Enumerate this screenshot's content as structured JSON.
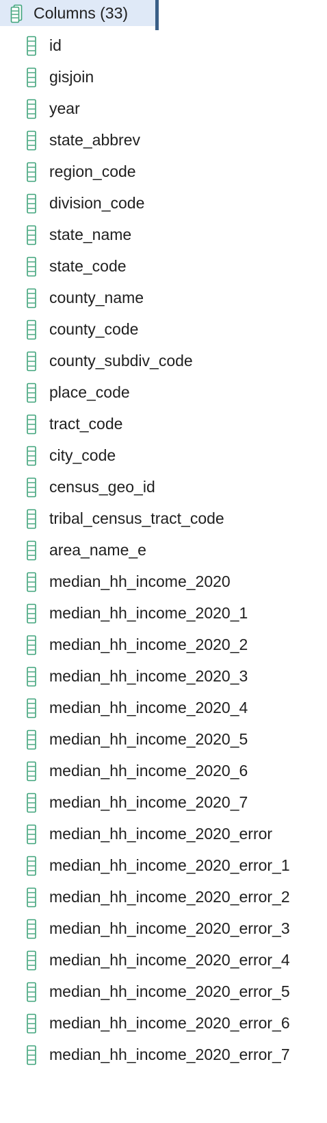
{
  "accent": {
    "icon_green": "#3fa37a",
    "selection_bg": "#dfe9f7",
    "selection_bar": "#3a5f87"
  },
  "header": {
    "label": "Columns (33)",
    "icon": "columns-folder-icon"
  },
  "column_icon": "column-icon",
  "columns": [
    {
      "name": "id"
    },
    {
      "name": "gisjoin"
    },
    {
      "name": "year"
    },
    {
      "name": "state_abbrev"
    },
    {
      "name": "region_code"
    },
    {
      "name": "division_code"
    },
    {
      "name": "state_name"
    },
    {
      "name": "state_code"
    },
    {
      "name": "county_name"
    },
    {
      "name": "county_code"
    },
    {
      "name": "county_subdiv_code"
    },
    {
      "name": "place_code"
    },
    {
      "name": "tract_code"
    },
    {
      "name": "city_code"
    },
    {
      "name": "census_geo_id"
    },
    {
      "name": "tribal_census_tract_code"
    },
    {
      "name": "area_name_e"
    },
    {
      "name": "median_hh_income_2020"
    },
    {
      "name": "median_hh_income_2020_1"
    },
    {
      "name": "median_hh_income_2020_2"
    },
    {
      "name": "median_hh_income_2020_3"
    },
    {
      "name": "median_hh_income_2020_4"
    },
    {
      "name": "median_hh_income_2020_5"
    },
    {
      "name": "median_hh_income_2020_6"
    },
    {
      "name": "median_hh_income_2020_7"
    },
    {
      "name": "median_hh_income_2020_error"
    },
    {
      "name": "median_hh_income_2020_error_1"
    },
    {
      "name": "median_hh_income_2020_error_2"
    },
    {
      "name": "median_hh_income_2020_error_3"
    },
    {
      "name": "median_hh_income_2020_error_4"
    },
    {
      "name": "median_hh_income_2020_error_5"
    },
    {
      "name": "median_hh_income_2020_error_6"
    },
    {
      "name": "median_hh_income_2020_error_7"
    }
  ]
}
